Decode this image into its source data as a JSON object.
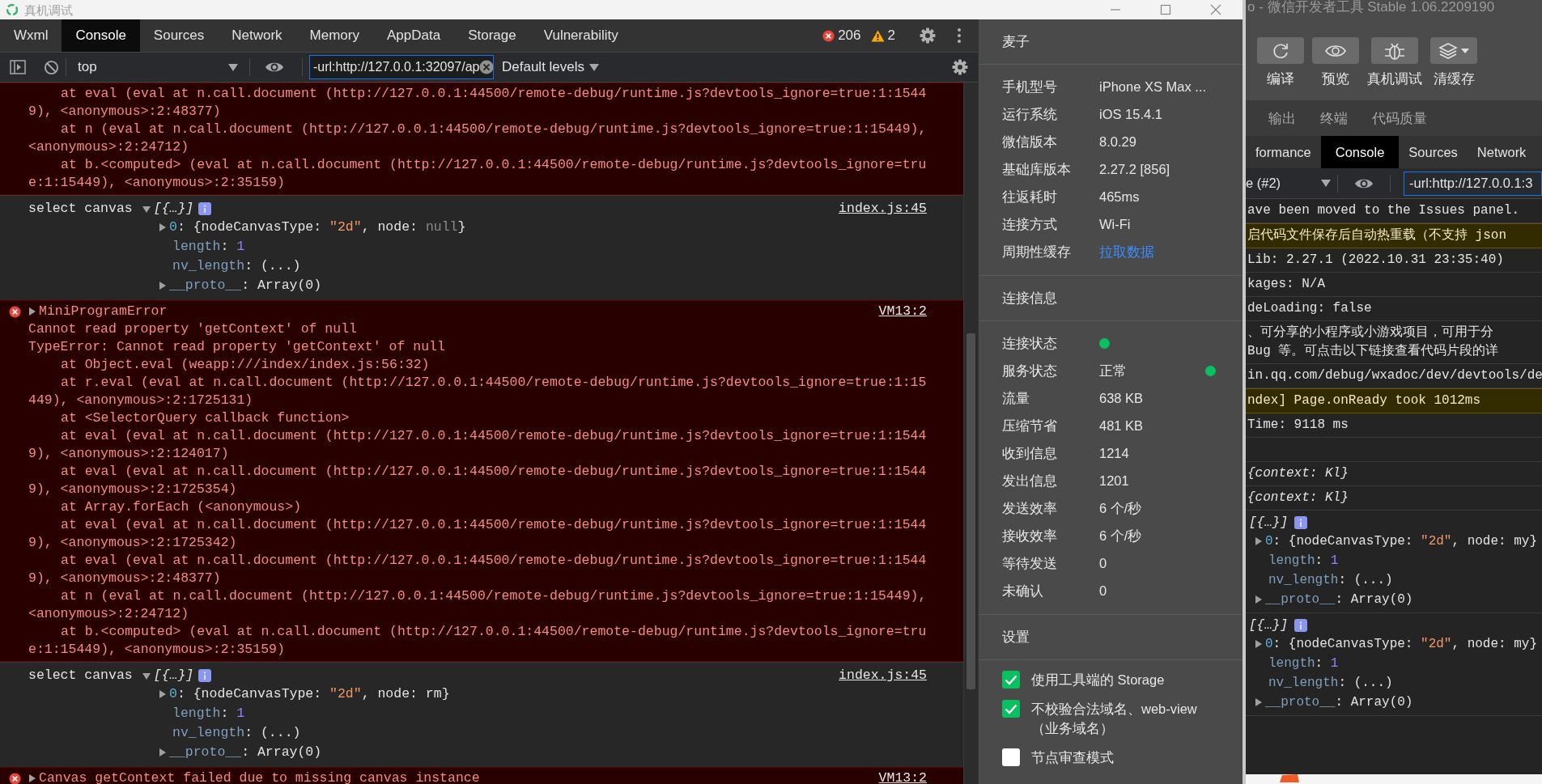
{
  "titlebar": {
    "title": "真机调试"
  },
  "devtools": {
    "tabs": [
      {
        "label": "Wxml",
        "selected": false
      },
      {
        "label": "Console",
        "selected": true
      },
      {
        "label": "Sources",
        "selected": false
      },
      {
        "label": "Network",
        "selected": false
      },
      {
        "label": "Memory",
        "selected": false
      },
      {
        "label": "AppData",
        "selected": false
      },
      {
        "label": "Storage",
        "selected": false
      },
      {
        "label": "Vulnerability",
        "selected": false
      }
    ],
    "errors": "206",
    "warnings": "2",
    "toolbar": {
      "context": "top",
      "filter": "-url:http://127.0.0.1:32097/ap",
      "levels": "Default levels"
    },
    "console": [
      {
        "kind": "error",
        "lines": [
          {
            "indent": true,
            "text": "at eval (eval at n.call.document (",
            "link": "http://127.0.0.1:44500/remote-debug/runtime.js?devtools_ignore=true:1:1544"
          },
          {
            "link": "9",
            "tail": "), <anonymous>:2:48377)"
          },
          {
            "indent": true,
            "text": "at n (eval at n.call.document (",
            "link": "http://127.0.0.1:44500/remote-debug/runtime.js?devtools_ignore=true:1:15449",
            "tail": "),"
          },
          {
            "text": "<anonymous>:2:24712)"
          },
          {
            "indent": true,
            "text": "at b.<computed> (eval at n.call.document (",
            "link": "http://127.0.0.1:44500/remote-debug/runtime.js?devtools_ignore=tru"
          },
          {
            "link": "e:1:15449",
            "tail": "), <anonymous>:2:35159)"
          }
        ]
      },
      {
        "kind": "log",
        "text": "select canvas",
        "summary": "[{…}]",
        "expanded": true,
        "source": "index.js:45",
        "props": [
          {
            "expandable": true,
            "parts": [
              {
                "text": "0",
                "kind": "index"
              },
              {
                "text": ": {nodeCanvasType: "
              },
              {
                "text": "\"2d\"",
                "kind": "string"
              },
              {
                "text": ", node: "
              },
              {
                "text": "null",
                "kind": "null"
              },
              {
                "text": "}"
              }
            ]
          },
          {
            "parts": [
              {
                "text": "length",
                "kind": "key"
              },
              {
                "text": ": "
              },
              {
                "text": "1",
                "kind": "number"
              }
            ]
          },
          {
            "parts": [
              {
                "text": "nv_length",
                "kind": "key"
              },
              {
                "text": ": (...)"
              }
            ]
          },
          {
            "expandable": true,
            "parts": [
              {
                "text": "__proto__",
                "kind": "key"
              },
              {
                "text": ": Array(0)"
              }
            ]
          }
        ]
      },
      {
        "kind": "error",
        "message": "MiniProgramError",
        "expanded": false,
        "source": "VM13:2",
        "lines": [
          {
            "text": "Cannot read property 'getContext' of null"
          },
          {
            "text": "TypeError: Cannot read property 'getContext' of null"
          },
          {
            "indent": true,
            "text": "at Object.eval (",
            "link": "weapp:///index/index.js:56:32",
            "tail": ")"
          },
          {
            "indent": true,
            "text": "at r.eval (eval at n.call.document (",
            "link": "http://127.0.0.1:44500/remote-debug/runtime.js?devtools_ignore=true:1:15"
          },
          {
            "link": "449",
            "tail": "), <anonymous>:2:1725131)"
          },
          {
            "indent": true,
            "text": "at <SelectorQuery callback function>"
          },
          {
            "indent": true,
            "text": "at eval (eval at n.call.document (",
            "link": "http://127.0.0.1:44500/remote-debug/runtime.js?devtools_ignore=true:1:1544"
          },
          {
            "link": "9",
            "tail": "), <anonymous>:2:124017)"
          },
          {
            "indent": true,
            "text": "at eval (eval at n.call.document (",
            "link": "http://127.0.0.1:44500/remote-debug/runtime.js?devtools_ignore=true:1:1544"
          },
          {
            "link": "9",
            "tail": "), <anonymous>:2:1725354)"
          },
          {
            "indent": true,
            "text": "at Array.forEach (<anonymous>)"
          },
          {
            "indent": true,
            "text": "at eval (eval at n.call.document (",
            "link": "http://127.0.0.1:44500/remote-debug/runtime.js?devtools_ignore=true:1:1544"
          },
          {
            "link": "9",
            "tail": "), <anonymous>:2:1725342)"
          },
          {
            "indent": true,
            "text": "at eval (eval at n.call.document (",
            "link": "http://127.0.0.1:44500/remote-debug/runtime.js?devtools_ignore=true:1:1544"
          },
          {
            "link": "9",
            "tail": "), <anonymous>:2:48377)"
          },
          {
            "indent": true,
            "text": "at n (eval at n.call.document (",
            "link": "http://127.0.0.1:44500/remote-debug/runtime.js?devtools_ignore=true:1:15449",
            "tail": "),"
          },
          {
            "text": "<anonymous>:2:24712)"
          },
          {
            "indent": true,
            "text": "at b.<computed> (eval at n.call.document (",
            "link": "http://127.0.0.1:44500/remote-debug/runtime.js?devtools_ignore=tru"
          },
          {
            "link": "e:1:15449",
            "tail": "), <anonymous>:2:35159)"
          }
        ]
      },
      {
        "kind": "log",
        "text": "select canvas",
        "summary": "[{…}]",
        "expanded": true,
        "source": "index.js:45",
        "props": [
          {
            "expandable": true,
            "parts": [
              {
                "text": "0",
                "kind": "index"
              },
              {
                "text": ": {nodeCanvasType: "
              },
              {
                "text": "\"2d\"",
                "kind": "string"
              },
              {
                "text": ", node: rm}"
              }
            ]
          },
          {
            "parts": [
              {
                "text": "length",
                "kind": "key"
              },
              {
                "text": ": "
              },
              {
                "text": "1",
                "kind": "number"
              }
            ]
          },
          {
            "parts": [
              {
                "text": "nv_length",
                "kind": "key"
              },
              {
                "text": ": (...)"
              }
            ]
          },
          {
            "expandable": true,
            "parts": [
              {
                "text": "__proto__",
                "kind": "key"
              },
              {
                "text": ": Array(0)"
              }
            ]
          }
        ]
      },
      {
        "kind": "error",
        "message": "Canvas getContext failed due to missing canvas instance",
        "expanded": false,
        "source": "VM13:2"
      }
    ]
  },
  "device_panel": {
    "name": "麦子",
    "info": [
      {
        "label": "手机型号",
        "value": "iPhone XS Max ...",
        "kind": "text"
      },
      {
        "label": "运行系统",
        "value": "iOS 15.4.1",
        "kind": "text"
      },
      {
        "label": "微信版本",
        "value": "8.0.29",
        "kind": "text"
      },
      {
        "label": "基础库版本",
        "value": "2.27.2 [856]",
        "kind": "text"
      },
      {
        "label": "往返耗时",
        "value": "465ms",
        "kind": "text"
      },
      {
        "label": "连接方式",
        "value": "Wi-Fi",
        "kind": "text"
      },
      {
        "label": "周期性缓存",
        "value": "拉取数据",
        "kind": "link"
      }
    ],
    "connection_title": "连接信息",
    "connection": [
      {
        "label": "连接状态",
        "kind": "dot",
        "color": "#07c160"
      },
      {
        "label": "服务状态",
        "value": "正常",
        "kind": "text",
        "color": "#07c160"
      },
      {
        "label": "流量",
        "value": "638 KB",
        "kind": "text"
      },
      {
        "label": "压缩节省",
        "value": "481 KB",
        "kind": "text"
      },
      {
        "label": "收到信息",
        "value": "1214",
        "kind": "text"
      },
      {
        "label": "发出信息",
        "value": "1201",
        "kind": "text"
      },
      {
        "label": "发送效率",
        "value": "6 个/秒",
        "kind": "text"
      },
      {
        "label": "接收效率",
        "value": "6 个/秒",
        "kind": "text"
      },
      {
        "label": "等待发送",
        "value": "0",
        "kind": "text"
      },
      {
        "label": "未确认",
        "value": "0",
        "kind": "text"
      }
    ],
    "settings_title": "设置",
    "settings": [
      {
        "label": "使用工具端的 Storage",
        "checked": true
      },
      {
        "label": "不校验合法域名、web-view（业务域名）",
        "checked": true
      },
      {
        "label": "节点审查模式",
        "checked": false
      }
    ]
  },
  "background_window": {
    "title": "o - 微信开发者工具 Stable 1.06.2209190",
    "tools": [
      {
        "label": "编译"
      },
      {
        "label": "预览"
      },
      {
        "label": "真机调试"
      },
      {
        "label": "清缓存",
        "menu": true
      }
    ],
    "panel_tabs": [
      {
        "label": "输出"
      },
      {
        "label": "终端"
      },
      {
        "label": "代码质量"
      }
    ],
    "devtools_tabs": [
      {
        "label": "formance",
        "selected": false
      },
      {
        "label": "Console",
        "selected": true
      },
      {
        "label": "Sources",
        "selected": false
      },
      {
        "label": "Network",
        "selected": false
      }
    ],
    "context": "e (#2)",
    "filter": "-url:http://127.0.0.1:3",
    "console": [
      {
        "kind": "text",
        "lines": [
          "ave been moved to the Issues panel."
        ]
      },
      {
        "kind": "warning",
        "lines": [
          "启代码文件保存后自动热重载（不支持 json"
        ]
      },
      {
        "kind": "text",
        "lines": [
          "Lib: 2.27.1 (2022.10.31 23:35:40)"
        ]
      },
      {
        "kind": "text",
        "lines": [
          "kages: N/A"
        ]
      },
      {
        "kind": "text",
        "lines": [
          "deLoading: false"
        ]
      },
      {
        "kind": "text",
        "lines": [
          "、可分享的小程序或小游戏项目，可用于分",
          "Bug 等。可点击以下链接查看代码片段的详"
        ]
      },
      {
        "kind": "link",
        "lines": [
          "in.qq.com/debug/wxadoc/dev/devtools/de"
        ]
      },
      {
        "kind": "warning",
        "lines": [
          "ndex] Page.onReady took 1012ms"
        ]
      },
      {
        "kind": "text",
        "lines": [
          "Time: 9118 ms"
        ]
      },
      {
        "kind": "blank"
      },
      {
        "kind": "object",
        "lines": [
          "{context: Kl}"
        ]
      },
      {
        "kind": "object",
        "lines": [
          "{context: Kl}"
        ]
      },
      {
        "kind": "group",
        "summary": "[{…}]",
        "props": [
          {
            "expandable": true,
            "parts": [
              {
                "text": "0",
                "kind": "index"
              },
              {
                "text": ": {nodeCanvasType: "
              },
              {
                "text": "\"2d\"",
                "kind": "string"
              },
              {
                "text": ", node: my}"
              }
            ]
          },
          {
            "parts": [
              {
                "text": "length",
                "kind": "key"
              },
              {
                "text": ": "
              },
              {
                "text": "1",
                "kind": "number"
              }
            ]
          },
          {
            "parts": [
              {
                "text": "nv_length",
                "kind": "key"
              },
              {
                "text": ": (...)"
              }
            ]
          },
          {
            "expandable": true,
            "parts": [
              {
                "text": "__proto__",
                "kind": "key"
              },
              {
                "text": ": Array(0)"
              }
            ]
          }
        ]
      },
      {
        "kind": "group",
        "summary": "[{…}]",
        "props": [
          {
            "expandable": true,
            "parts": [
              {
                "text": "0",
                "kind": "index"
              },
              {
                "text": ": {nodeCanvasType: "
              },
              {
                "text": "\"2d\"",
                "kind": "string"
              },
              {
                "text": ", node: my}"
              }
            ]
          },
          {
            "parts": [
              {
                "text": "length",
                "kind": "key"
              },
              {
                "text": ": "
              },
              {
                "text": "1",
                "kind": "number"
              }
            ]
          },
          {
            "parts": [
              {
                "text": "nv_length",
                "kind": "key"
              },
              {
                "text": ": (...)"
              }
            ]
          },
          {
            "expandable": true,
            "parts": [
              {
                "text": "__proto__",
                "kind": "key"
              },
              {
                "text": ": Array(0)"
              }
            ]
          }
        ]
      }
    ]
  }
}
